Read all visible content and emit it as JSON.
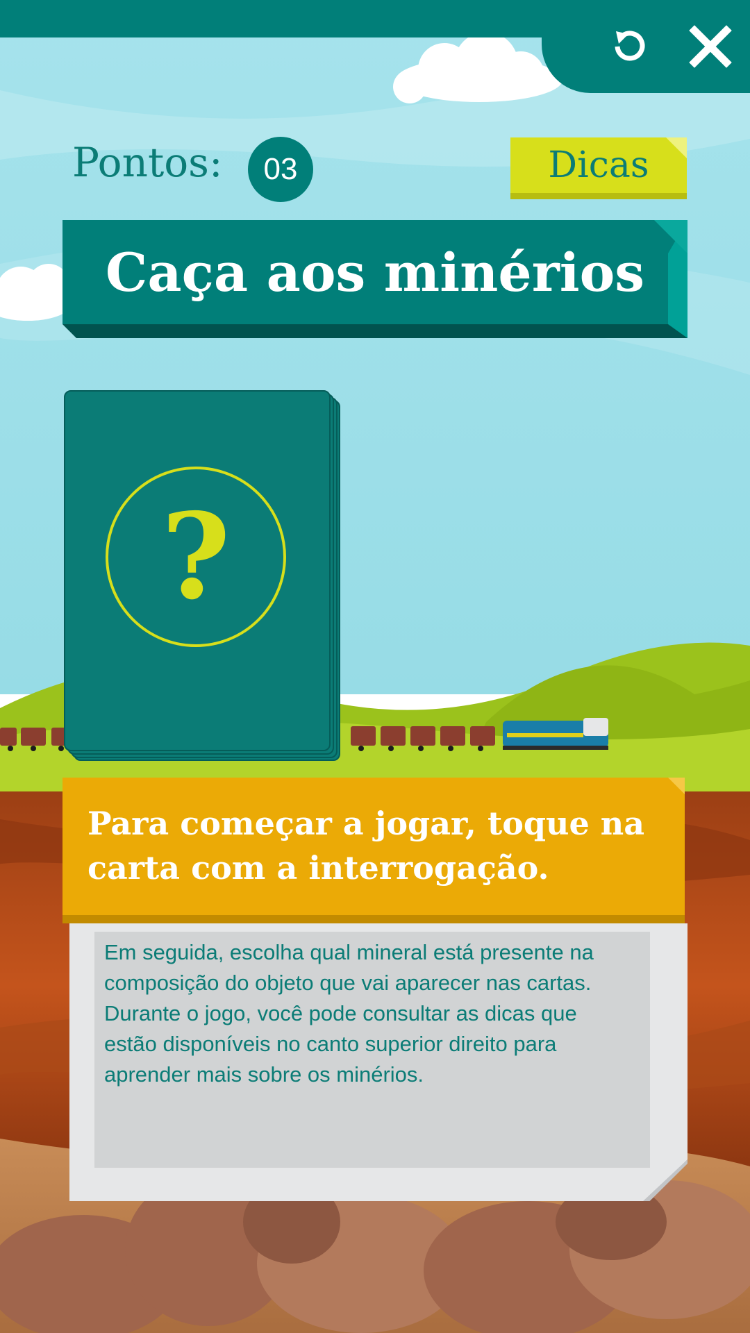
{
  "header": {
    "restart_icon": "restart-icon",
    "close_icon": "close-icon"
  },
  "score": {
    "label": "Pontos:",
    "value": "03"
  },
  "hints_button": {
    "label": "Dicas"
  },
  "title": "Caça aos minérios",
  "card": {
    "symbol": "?"
  },
  "instruction": {
    "text": "Para começar a jogar, toque na carta com a interrogação."
  },
  "description": {
    "text": "Em seguida, escolha qual mineral está presente na composição do objeto que vai aparecer nas cartas. Durante o jogo, você pode consultar as dicas que estão disponíveis no canto superior direito para aprender mais sobre os minérios."
  },
  "colors": {
    "teal": "#017f79",
    "yellow_green": "#d7df1b",
    "orange": "#ebaa06",
    "sky": "#9ddfe8"
  }
}
